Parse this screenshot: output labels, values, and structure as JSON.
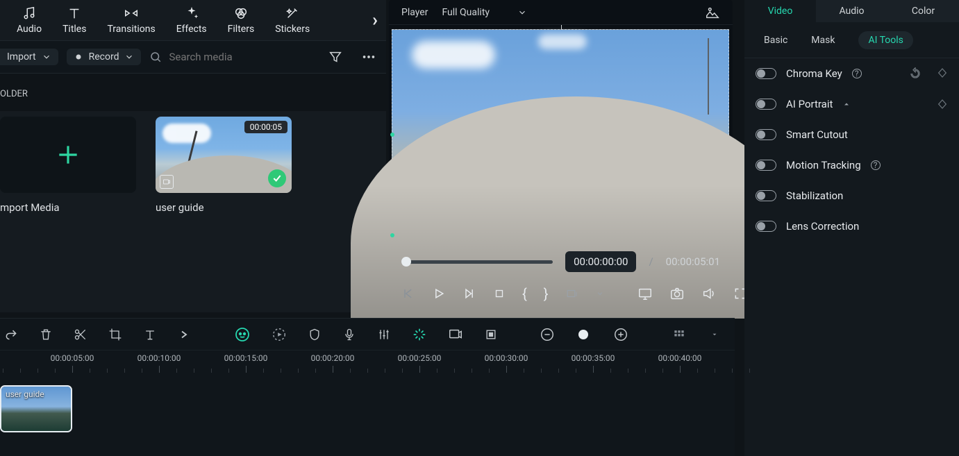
{
  "top_tabs": {
    "audio": "Audio",
    "titles": "Titles",
    "transitions": "Transitions",
    "effects": "Effects",
    "filters": "Filters",
    "stickers": "Stickers"
  },
  "media_toolbar": {
    "import_label": "Import",
    "record_label": "Record",
    "search_placeholder": "Search media"
  },
  "folder_label": "OLDER",
  "bin": {
    "import_caption": "mport Media",
    "clip_caption": "user guide",
    "clip_duration": "00:00:05"
  },
  "player": {
    "label": "Player",
    "quality": "Full Quality",
    "tc_current": "00:00:00:00",
    "tc_sep": "/",
    "tc_total": "00:00:05:01"
  },
  "inspector": {
    "tabs": {
      "video": "Video",
      "audio": "Audio",
      "color": "Color"
    },
    "subtabs": {
      "basic": "Basic",
      "mask": "Mask",
      "ai": "AI Tools"
    },
    "tools": {
      "chroma": "Chroma Key",
      "portrait": "AI Portrait",
      "cutout": "Smart Cutout",
      "tracking": "Motion Tracking",
      "stabilization": "Stabilization",
      "lens": "Lens Correction"
    }
  },
  "timeline": {
    "labels": [
      "00:00:05:00",
      "00:00:10:00",
      "00:00:15:00",
      "00:00:20:00",
      "00:00:25:00",
      "00:00:30:00",
      "00:00:35:00",
      "00:00:40:00"
    ],
    "clip_label": "user guide"
  }
}
